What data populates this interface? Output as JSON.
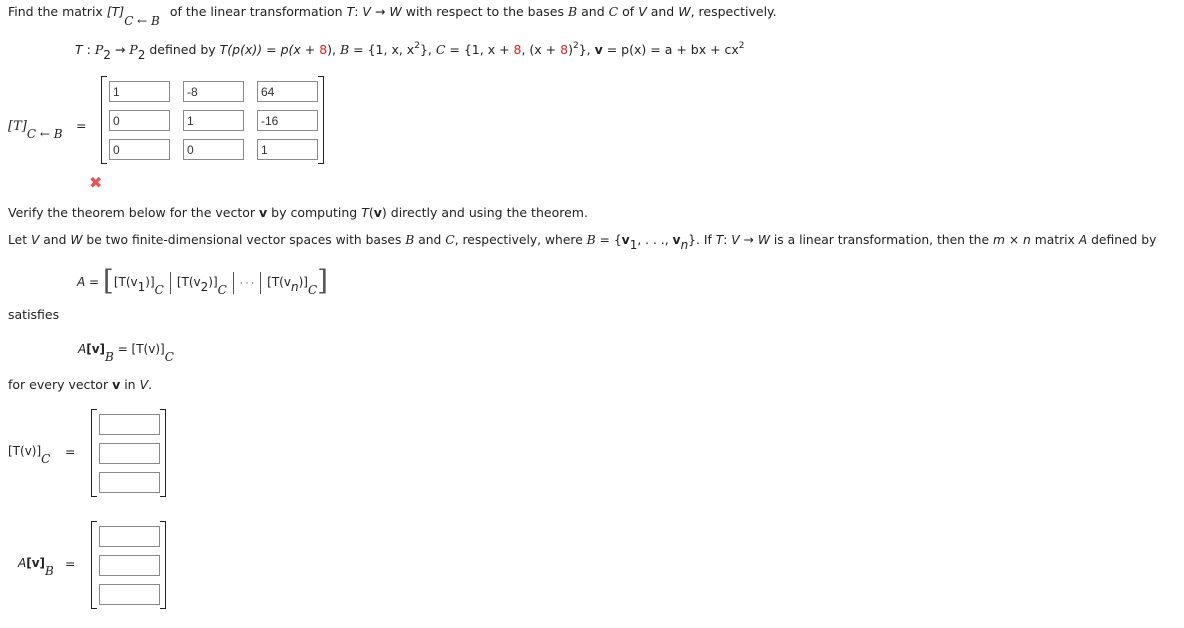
{
  "question": {
    "intro_prefix": "Find the matrix ",
    "intro_T": "[T]",
    "intro_subscript": "C ← B",
    "intro_suffix_1": "of the linear transformation ",
    "intro_T2": "T",
    "intro_suffix_2": ": ",
    "intro_V": "V",
    "intro_arrow": " → ",
    "intro_W": "W",
    "intro_suffix_3": " with respect to the bases ",
    "intro_B": "B",
    "intro_and": " and ",
    "intro_C": "C",
    "intro_of": " of ",
    "intro_V2": "V",
    "intro_and2": " and ",
    "intro_W2": "W",
    "intro_end": ", respectively."
  },
  "definition": {
    "T": "T",
    "colon": " : ",
    "P": "P",
    "sub2": "2",
    "arrow": " → ",
    "defined_by": " defined by ",
    "Tp": "T(p(x))",
    "eq": " = ",
    "px8_a": "p(x + ",
    "eight": "8",
    "px8_b": "), ",
    "B": "B",
    "B_set": " = {1, x, x",
    "sq": "2",
    "B_set_end": "}, ",
    "C": "C",
    "C_set_a": " = {1, x + ",
    "C_set_b": ", (x + ",
    "C_set_c": ")",
    "C_set_end": "}, ",
    "v": "v",
    "v_eq": " = p(x) = a + bx + cx",
    "v_sq": "2"
  },
  "matrix_label": {
    "T": "[T]",
    "subscript": "C ← B",
    "equals": "="
  },
  "matrix_values": [
    [
      "1",
      "-8",
      "64"
    ],
    [
      "0",
      "1",
      "-16"
    ],
    [
      "0",
      "0",
      "1"
    ]
  ],
  "status": {
    "incorrect_icon": "✖",
    "incorrect_color": "#e8525a"
  },
  "verify": {
    "line1_a": "Verify the theorem below for the vector ",
    "line1_v": "v",
    "line1_b": " by computing ",
    "line1_T": "T",
    "line1_c": "(",
    "line1_v2": "v",
    "line1_d": ") directly and using the theorem."
  },
  "theorem": {
    "t1": "Let ",
    "V": "V",
    "t2": " and ",
    "W": "W",
    "t3": " be two finite-dimensional vector spaces with bases ",
    "B": "B",
    "t4": " and ",
    "C": "C",
    "t5": ", respectively, where ",
    "B2": "B",
    "t6": " = {",
    "v1": "v",
    "one": "1",
    "t7": ", . . ., ",
    "vn": "v",
    "n": "n",
    "t8": "}. If ",
    "T": "T",
    "t9": ": ",
    "V2": "V",
    "t10": " → ",
    "W2": "W",
    "t11": " is a linear transformation, then the ",
    "m": "m",
    "t12": " × ",
    "nn": "n",
    "t13": " matrix ",
    "A": "A",
    "t14": " defined by"
  },
  "formula_A": {
    "A": "A",
    "eq": " = ",
    "lb": "[",
    "rb": "]",
    "term1": "[T(v",
    "sub1": "1",
    "term_close": ")]",
    "C": "C",
    "term2": "[T(v",
    "sub2": "2",
    "dots": "· · ·",
    "termn": "[T(v",
    "subn": "n"
  },
  "satisfies": "satisfies",
  "formula_Av": {
    "A": "A",
    "lhs": "[v]",
    "B": "B",
    "eq": " = ",
    "rhs": "[T(v)]",
    "C": "C"
  },
  "for_every": {
    "a": "for every vector ",
    "v": "v",
    "b": " in ",
    "V": "V",
    "c": "."
  },
  "Tv_answer": {
    "label": "[T(v)]",
    "subscript": "C",
    "equals": "=",
    "values": [
      "",
      "",
      ""
    ]
  },
  "Av_answer": {
    "label_A": "A",
    "label": "[v]",
    "subscript": "B",
    "equals": "=",
    "values": [
      "",
      "",
      ""
    ]
  }
}
